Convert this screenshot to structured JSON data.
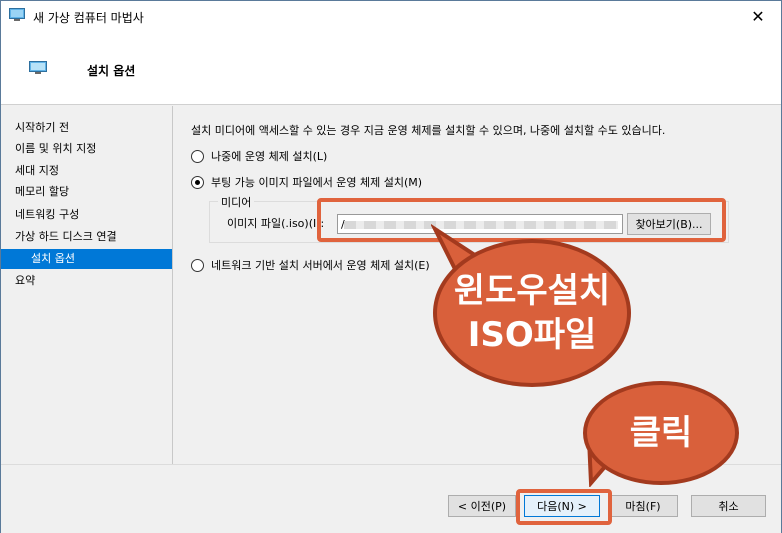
{
  "window": {
    "title": "새 가상 컴퓨터 마법사",
    "close_glyph": "✕"
  },
  "header": {
    "title": "설치 옵션",
    "icon": "monitor-icon"
  },
  "sidebar": {
    "items": [
      {
        "label": "시작하기 전",
        "selected": false
      },
      {
        "label": "이름 및 위치 지정",
        "selected": false
      },
      {
        "label": "세대 지정",
        "selected": false
      },
      {
        "label": "메모리 할당",
        "selected": false
      },
      {
        "label": "네트워킹 구성",
        "selected": false
      },
      {
        "label": "가상 하드 디스크 연결",
        "selected": false
      },
      {
        "label": "설치 옵션",
        "selected": true
      },
      {
        "label": "요약",
        "selected": false
      }
    ]
  },
  "content": {
    "description": "설치 미디어에 액세스할 수 있는 경우 지금 운영 체제를 설치할 수 있으며, 나중에 설치할 수도 있습니다.",
    "options": [
      {
        "label": "나중에 운영 체제 설치(L)",
        "checked": false
      },
      {
        "label": "부팅 가능 이미지 파일에서 운영 체제 설치(M)",
        "checked": true
      },
      {
        "label": "네트워크 기반 설치 서버에서 운영 체제 설치(E)",
        "checked": false
      }
    ],
    "media_group": {
      "legend": "미디어",
      "file_label": "이미지 파일(.iso)(I):",
      "file_value_visible": "/",
      "browse_label": "찾아보기(B)..."
    }
  },
  "footer": {
    "prev_label": "< 이전(P)",
    "next_label": "다음(N) >",
    "finish_label": "마침(F)",
    "cancel_label": "취소"
  },
  "annotations": {
    "bubble1_line1": "윈도우설치",
    "bubble1_line2": "ISO파일",
    "bubble2_text": "클릭",
    "highlight_color": "#e0633d",
    "bubble_color": "#d9603b"
  }
}
